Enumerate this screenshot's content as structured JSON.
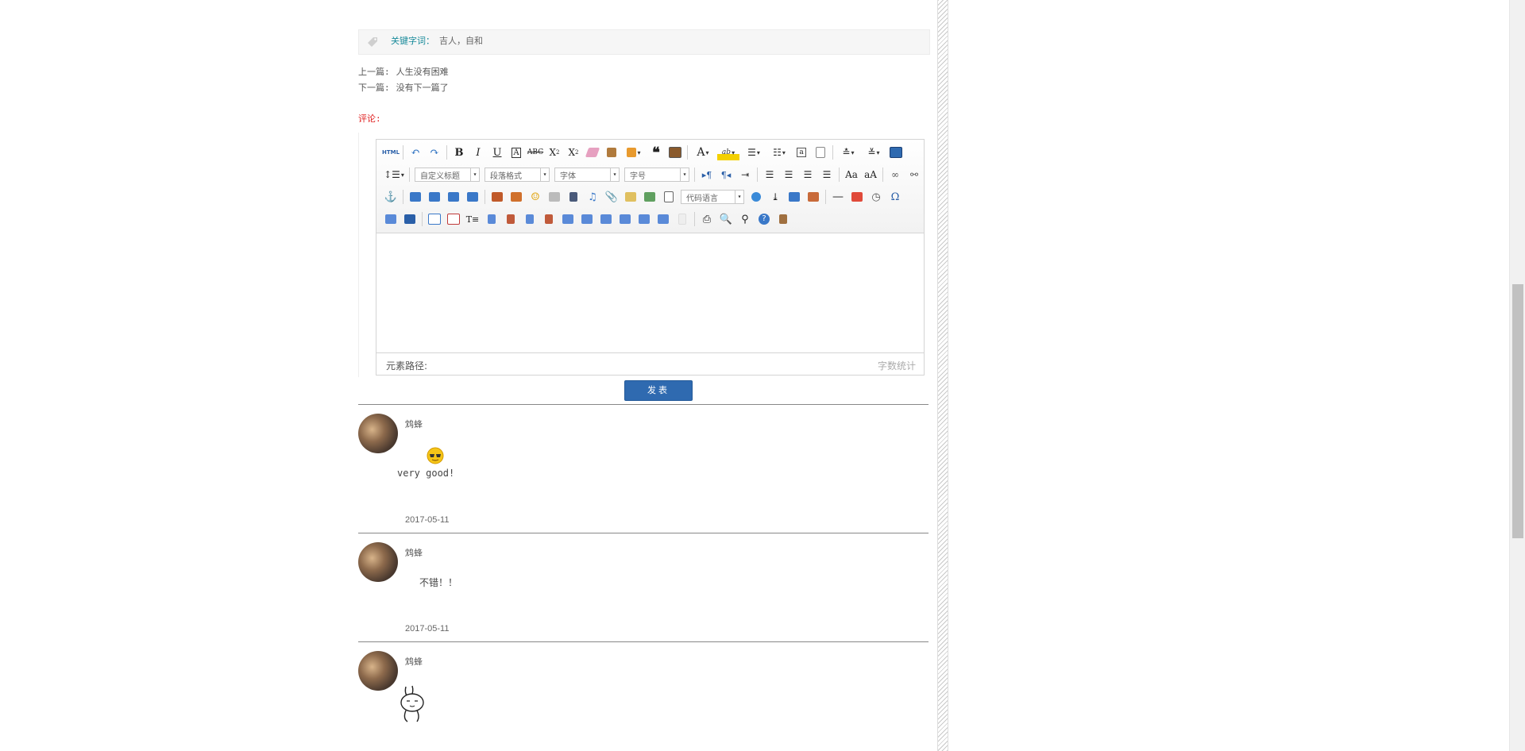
{
  "article": {
    "keywords_label": "关键字词：",
    "keywords_value": "吉人，自和",
    "prev_label": "上一篇:",
    "prev_title": "人生没有困难",
    "next_label": "下一篇:",
    "next_title": "没有下一篇了"
  },
  "comments_section": {
    "title": "评论:"
  },
  "editor": {
    "selects": {
      "custom_heading": "自定义标题",
      "paragraph_format": "段落格式",
      "font_family": "字体",
      "font_size": "字号",
      "code_language": "代码语言"
    },
    "html_label": "HTML",
    "element_path_label": "元素路径:",
    "word_count_label": "字数统计",
    "submit_label": "发表"
  },
  "comments": [
    {
      "author": "鸩蜂",
      "text": "very good!",
      "emoji": "cool-face-emoji",
      "date": "2017-05-11"
    },
    {
      "author": "鸩蜂",
      "text": "不错！！",
      "date": "2017-05-11"
    },
    {
      "author": "鸩蜂",
      "emoji": "rabbit-sticker"
    }
  ],
  "colors": {
    "keyword_label": "#178a9a",
    "comment_title": "#e02020",
    "submit_button": "#2f6ab0"
  }
}
